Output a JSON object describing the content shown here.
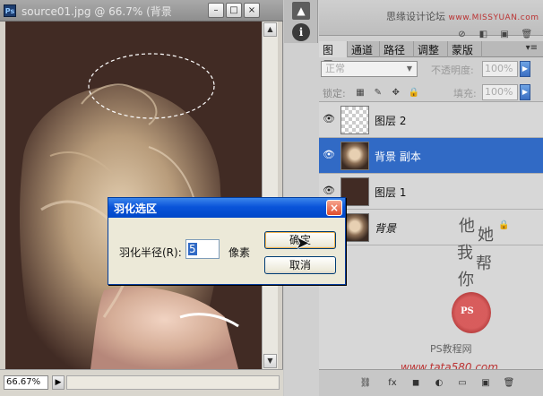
{
  "document": {
    "title": "source01.jpg @ 66.7% (背景",
    "zoom": "66.67%",
    "controls": [
      "–",
      "□",
      "×"
    ]
  },
  "top": {
    "watermark": "思缘设计论坛",
    "site": "www.MISSYUAN.com"
  },
  "panels": {
    "tabs": [
      "图层",
      "通道",
      "路径",
      "调整",
      "蒙版"
    ],
    "blend_mode": "正常",
    "opacity_label": "不透明度:",
    "opacity_value": "100%",
    "lock_label": "锁定:",
    "fill_label": "填充:",
    "fill_value": "100%",
    "layers": [
      {
        "name": "图层 2",
        "selected": false
      },
      {
        "name": "背景 副本",
        "selected": true
      },
      {
        "name": "图层 1",
        "selected": false
      },
      {
        "name": "背景",
        "selected": false
      }
    ]
  },
  "art": {
    "vertical_text": [
      "他",
      "她",
      "我",
      "帮",
      "你"
    ],
    "seal_text": "PS",
    "brand": "PS教程网",
    "site": "www.tata580.com"
  },
  "dialog": {
    "title": "羽化选区",
    "label": "羽化半径(R):",
    "value": "5",
    "unit": "像素",
    "ok": "确定",
    "cancel": "取消"
  },
  "colors": {
    "selection": "#316ac5",
    "canvas_bg": "#412b24",
    "dialog_title": "#0a54d9"
  }
}
